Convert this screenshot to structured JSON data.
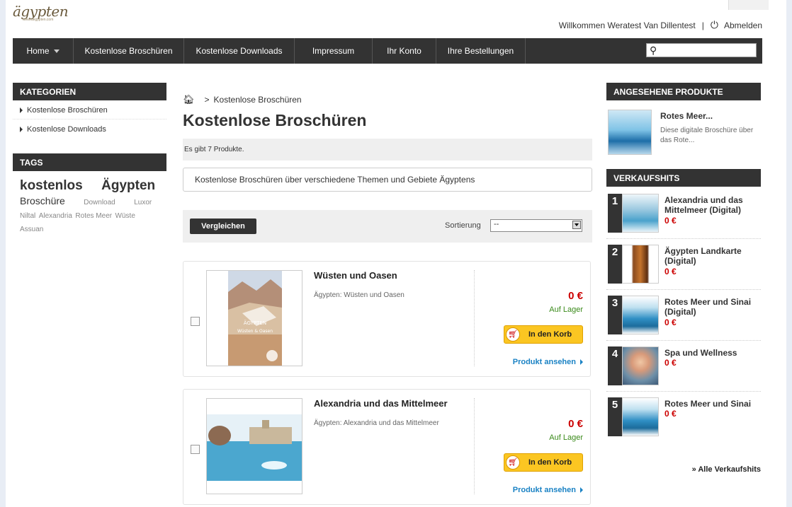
{
  "header": {
    "logo_text": "ägypten",
    "logo_sub": "www.aegypten.com",
    "welcome": "Willkommen Weratest Van Dillentest",
    "separator": "|",
    "logout": "Abmelden"
  },
  "nav": {
    "items": [
      {
        "label": "Home",
        "width": 86,
        "dropdown": true
      },
      {
        "label": "Kostenlose Broschüren",
        "width": 156
      },
      {
        "label": "Kostenlose Downloads",
        "width": 156
      },
      {
        "label": "Impressum",
        "width": 110
      },
      {
        "label": "Ihr Konto",
        "width": 90
      },
      {
        "label": "Ihre Bestellungen",
        "width": 126
      }
    ],
    "search_placeholder": ""
  },
  "left": {
    "categories_title": "KATEGORIEN",
    "categories": [
      "Kostenlose Broschüren",
      "Kostenlose Downloads"
    ],
    "tags_title": "TAGS",
    "tags": {
      "big1": "kostenlos",
      "big2": "Ägypten",
      "mid": "Broschüre",
      "sm": [
        "Download",
        "Luxor",
        "Niltal",
        "Alexandria",
        "Rotes Meer",
        "Wüste",
        "Assuan"
      ]
    }
  },
  "main": {
    "breadcrumb": "Kostenlose Broschüren",
    "breadcrumb_sep": ">",
    "title": "Kostenlose Broschüren",
    "count": "Es gibt 7 Produkte.",
    "description": "Kostenlose Broschüren über verschiedene Themen und Gebiete Ägyptens",
    "compare": "Vergleichen",
    "sort_label": "Sortierung",
    "sort_value": "--",
    "products": [
      {
        "name": "Wüsten und Oasen",
        "subtitle": "Ägypten: Wüsten und Oasen",
        "price": "0 €",
        "stock": "Auf Lager",
        "cart": "In den Korb",
        "view": "Produkt ansehen",
        "cover_text": "ÄGYPTEN",
        "cover_sub": "Wüsten & Oasen"
      },
      {
        "name": "Alexandria und das Mittelmeer",
        "subtitle": "Ägypten: Alexandria und das Mittelmeer",
        "price": "0 €",
        "stock": "Auf Lager",
        "cart": "In den Korb",
        "view": "Produkt ansehen"
      }
    ]
  },
  "right": {
    "viewed_title": "ANGESEHENE PRODUKTE",
    "viewed": {
      "title": "Rotes Meer...",
      "desc": "Diese digitale Broschüre über das Rote..."
    },
    "bestsellers_title": "VERKAUFSHITS",
    "bestsellers": [
      {
        "rank": "1",
        "title": "Alexandria und das Mittelmeer (Digital)",
        "price": "0 €"
      },
      {
        "rank": "2",
        "title": "Ägypten Landkarte (Digital)",
        "price": "0 €"
      },
      {
        "rank": "3",
        "title": "Rotes Meer und Sinai (Digital)",
        "price": "0 €"
      },
      {
        "rank": "4",
        "title": "Spa und Wellness",
        "price": "0 €"
      },
      {
        "rank": "5",
        "title": "Rotes Meer und Sinai",
        "price": "0 €"
      }
    ],
    "all_link": "» Alle Verkaufshits"
  }
}
